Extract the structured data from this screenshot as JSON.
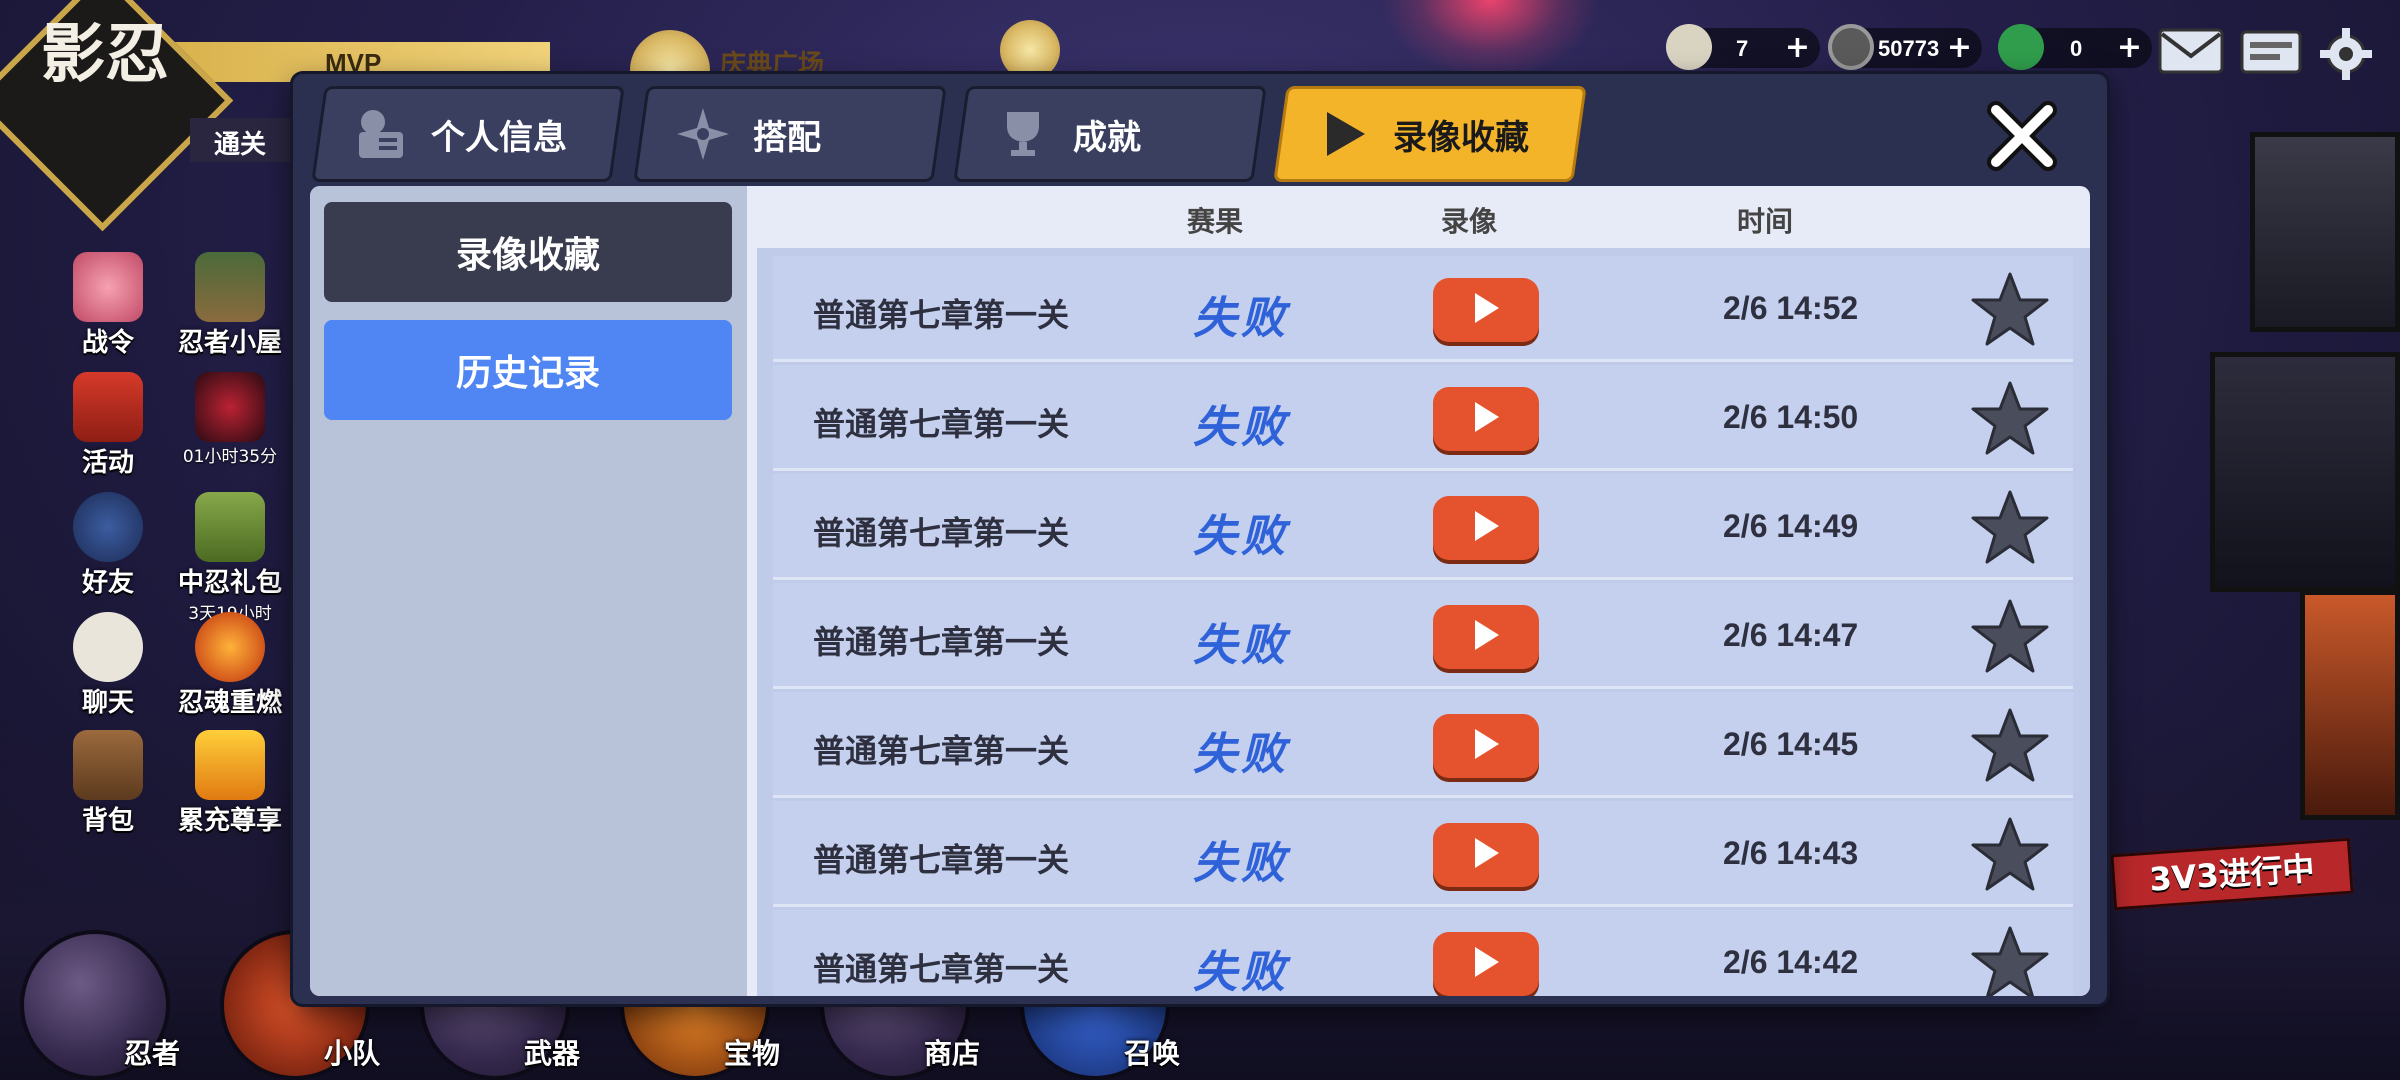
{
  "hud": {
    "logo_text": "影忍",
    "mvp_label": "MVP",
    "event_banner_label": "庆典广场",
    "clear_label": "通关"
  },
  "left_features": [
    {
      "label": "战令",
      "icon": "rose-icon"
    },
    {
      "label": "忍者小屋",
      "icon": "house-icon"
    },
    {
      "label": "活动",
      "icon": "torii-icon"
    },
    {
      "label": "",
      "icon": "dragon-icon",
      "sub": "01小时35分"
    },
    {
      "label": "好友",
      "icon": "ninja-face-icon"
    },
    {
      "label": "中忍礼包",
      "icon": "gift-icon",
      "sub": "3天19小时"
    },
    {
      "label": "聊天",
      "icon": "chat-bubble-icon"
    },
    {
      "label": "忍魂重燃",
      "icon": "flame-icon"
    },
    {
      "label": "背包",
      "icon": "backpack-icon"
    },
    {
      "label": "累充尊享",
      "icon": "ssr-icon"
    }
  ],
  "bottom_nav": [
    {
      "label": "忍者"
    },
    {
      "label": "小队"
    },
    {
      "label": "武器"
    },
    {
      "label": "宝物"
    },
    {
      "label": "商店"
    },
    {
      "label": "召唤"
    }
  ],
  "resources": [
    {
      "value": "7",
      "icon": "rice-ball-icon"
    },
    {
      "value": "50773",
      "icon": "coin-icon"
    },
    {
      "value": "0",
      "icon": "gem-icon"
    }
  ],
  "side_banner_text": "3V3进行中",
  "tabs": [
    {
      "label": "个人信息",
      "icon": "profile-card-icon",
      "active": false
    },
    {
      "label": "搭配",
      "icon": "shuriken-icon",
      "active": false
    },
    {
      "label": "成就",
      "icon": "trophy-icon",
      "active": false
    },
    {
      "label": "录像收藏",
      "icon": "play-triangle-icon",
      "active": true
    }
  ],
  "sidebar": {
    "favorites_label": "录像收藏",
    "history_label": "历史记录"
  },
  "columns": {
    "result": "赛果",
    "replay": "录像",
    "time": "时间"
  },
  "rows": [
    {
      "stage": "普通第七章第一关",
      "result": "失败",
      "time": "2/6 14:52"
    },
    {
      "stage": "普通第七章第一关",
      "result": "失败",
      "time": "2/6 14:50"
    },
    {
      "stage": "普通第七章第一关",
      "result": "失败",
      "time": "2/6 14:49"
    },
    {
      "stage": "普通第七章第一关",
      "result": "失败",
      "time": "2/6 14:47"
    },
    {
      "stage": "普通第七章第一关",
      "result": "失败",
      "time": "2/6 14:45"
    },
    {
      "stage": "普通第七章第一关",
      "result": "失败",
      "time": "2/6 14:43"
    },
    {
      "stage": "普通第七章第一关",
      "result": "失败",
      "time": "2/6 14:42"
    }
  ],
  "colors": {
    "accent_tab": "#f3b42a",
    "play_button": "#e4532d",
    "history_button": "#4f86f4",
    "result_text": "#2f62d8"
  }
}
